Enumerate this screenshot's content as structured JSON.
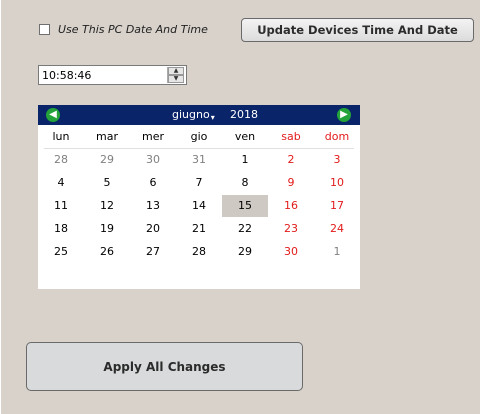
{
  "sync": {
    "checkbox_label": "Use This PC Date And Time",
    "update_button": "Update Devices Time And Date"
  },
  "time_picker": {
    "value": "10:58:46",
    "up_glyph": "▲",
    "down_glyph": "▼"
  },
  "calendar": {
    "month": "giugno",
    "year": "2018",
    "prev_icon": "arrow-left-icon",
    "next_icon": "arrow-right-icon",
    "prev_glyph": "◀",
    "next_glyph": "▶",
    "weekdays": [
      "lun",
      "mar",
      "mer",
      "gio",
      "ven",
      "sab",
      "dom"
    ],
    "weeks": [
      [
        "28",
        "29",
        "30",
        "31",
        "1",
        "2",
        "3"
      ],
      [
        "4",
        "5",
        "6",
        "7",
        "8",
        "9",
        "10"
      ],
      [
        "11",
        "12",
        "13",
        "14",
        "15",
        "16",
        "17"
      ],
      [
        "18",
        "19",
        "20",
        "21",
        "22",
        "23",
        "24"
      ],
      [
        "25",
        "26",
        "27",
        "28",
        "29",
        "30",
        "1"
      ]
    ],
    "selected_day": "15",
    "weekend_color": "#e31b1b",
    "header_color": "#0a246a"
  },
  "apply_button": "Apply All Changes"
}
